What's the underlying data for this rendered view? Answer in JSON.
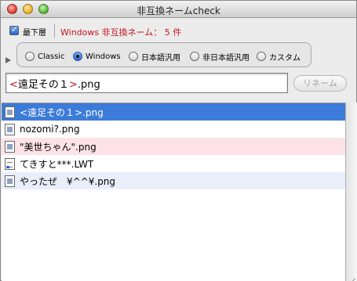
{
  "window": {
    "title": "非互換ネームcheck"
  },
  "toolbar": {
    "checkbox_label": "最下層",
    "checkbox_checked": true,
    "status": "Windows 非互換ネーム： 5 件",
    "status_color": "#c0141e"
  },
  "charset_options": {
    "options": [
      "Classic",
      "Windows",
      "日本語汎用",
      "非日本語汎用",
      "カスタム"
    ],
    "selected": "Windows"
  },
  "rename": {
    "input_bracket_open": "<",
    "input_core": "遠足その１",
    "input_bracket_close": ">",
    "input_suffix": ".png",
    "button_label": "リネーム",
    "button_enabled": false
  },
  "files": [
    {
      "name": "<遠足その１>.png",
      "icon": "image-file-icon",
      "state": "selected"
    },
    {
      "name": "nozomi?.png",
      "icon": "image-file-icon",
      "state": "normal"
    },
    {
      "name": "\"美世ちゃん\".png",
      "icon": "image-file-icon",
      "state": "pink"
    },
    {
      "name": "てきすと***.LWT",
      "icon": "document-file-icon",
      "state": "normal"
    },
    {
      "name": "やったぜ　¥^^¥.png",
      "icon": "image-file-icon",
      "state": "lavender"
    }
  ],
  "colors": {
    "selection": "#3c7bd9",
    "pink_row": "#fde3e7",
    "lavender_row": "#e9eefb"
  }
}
